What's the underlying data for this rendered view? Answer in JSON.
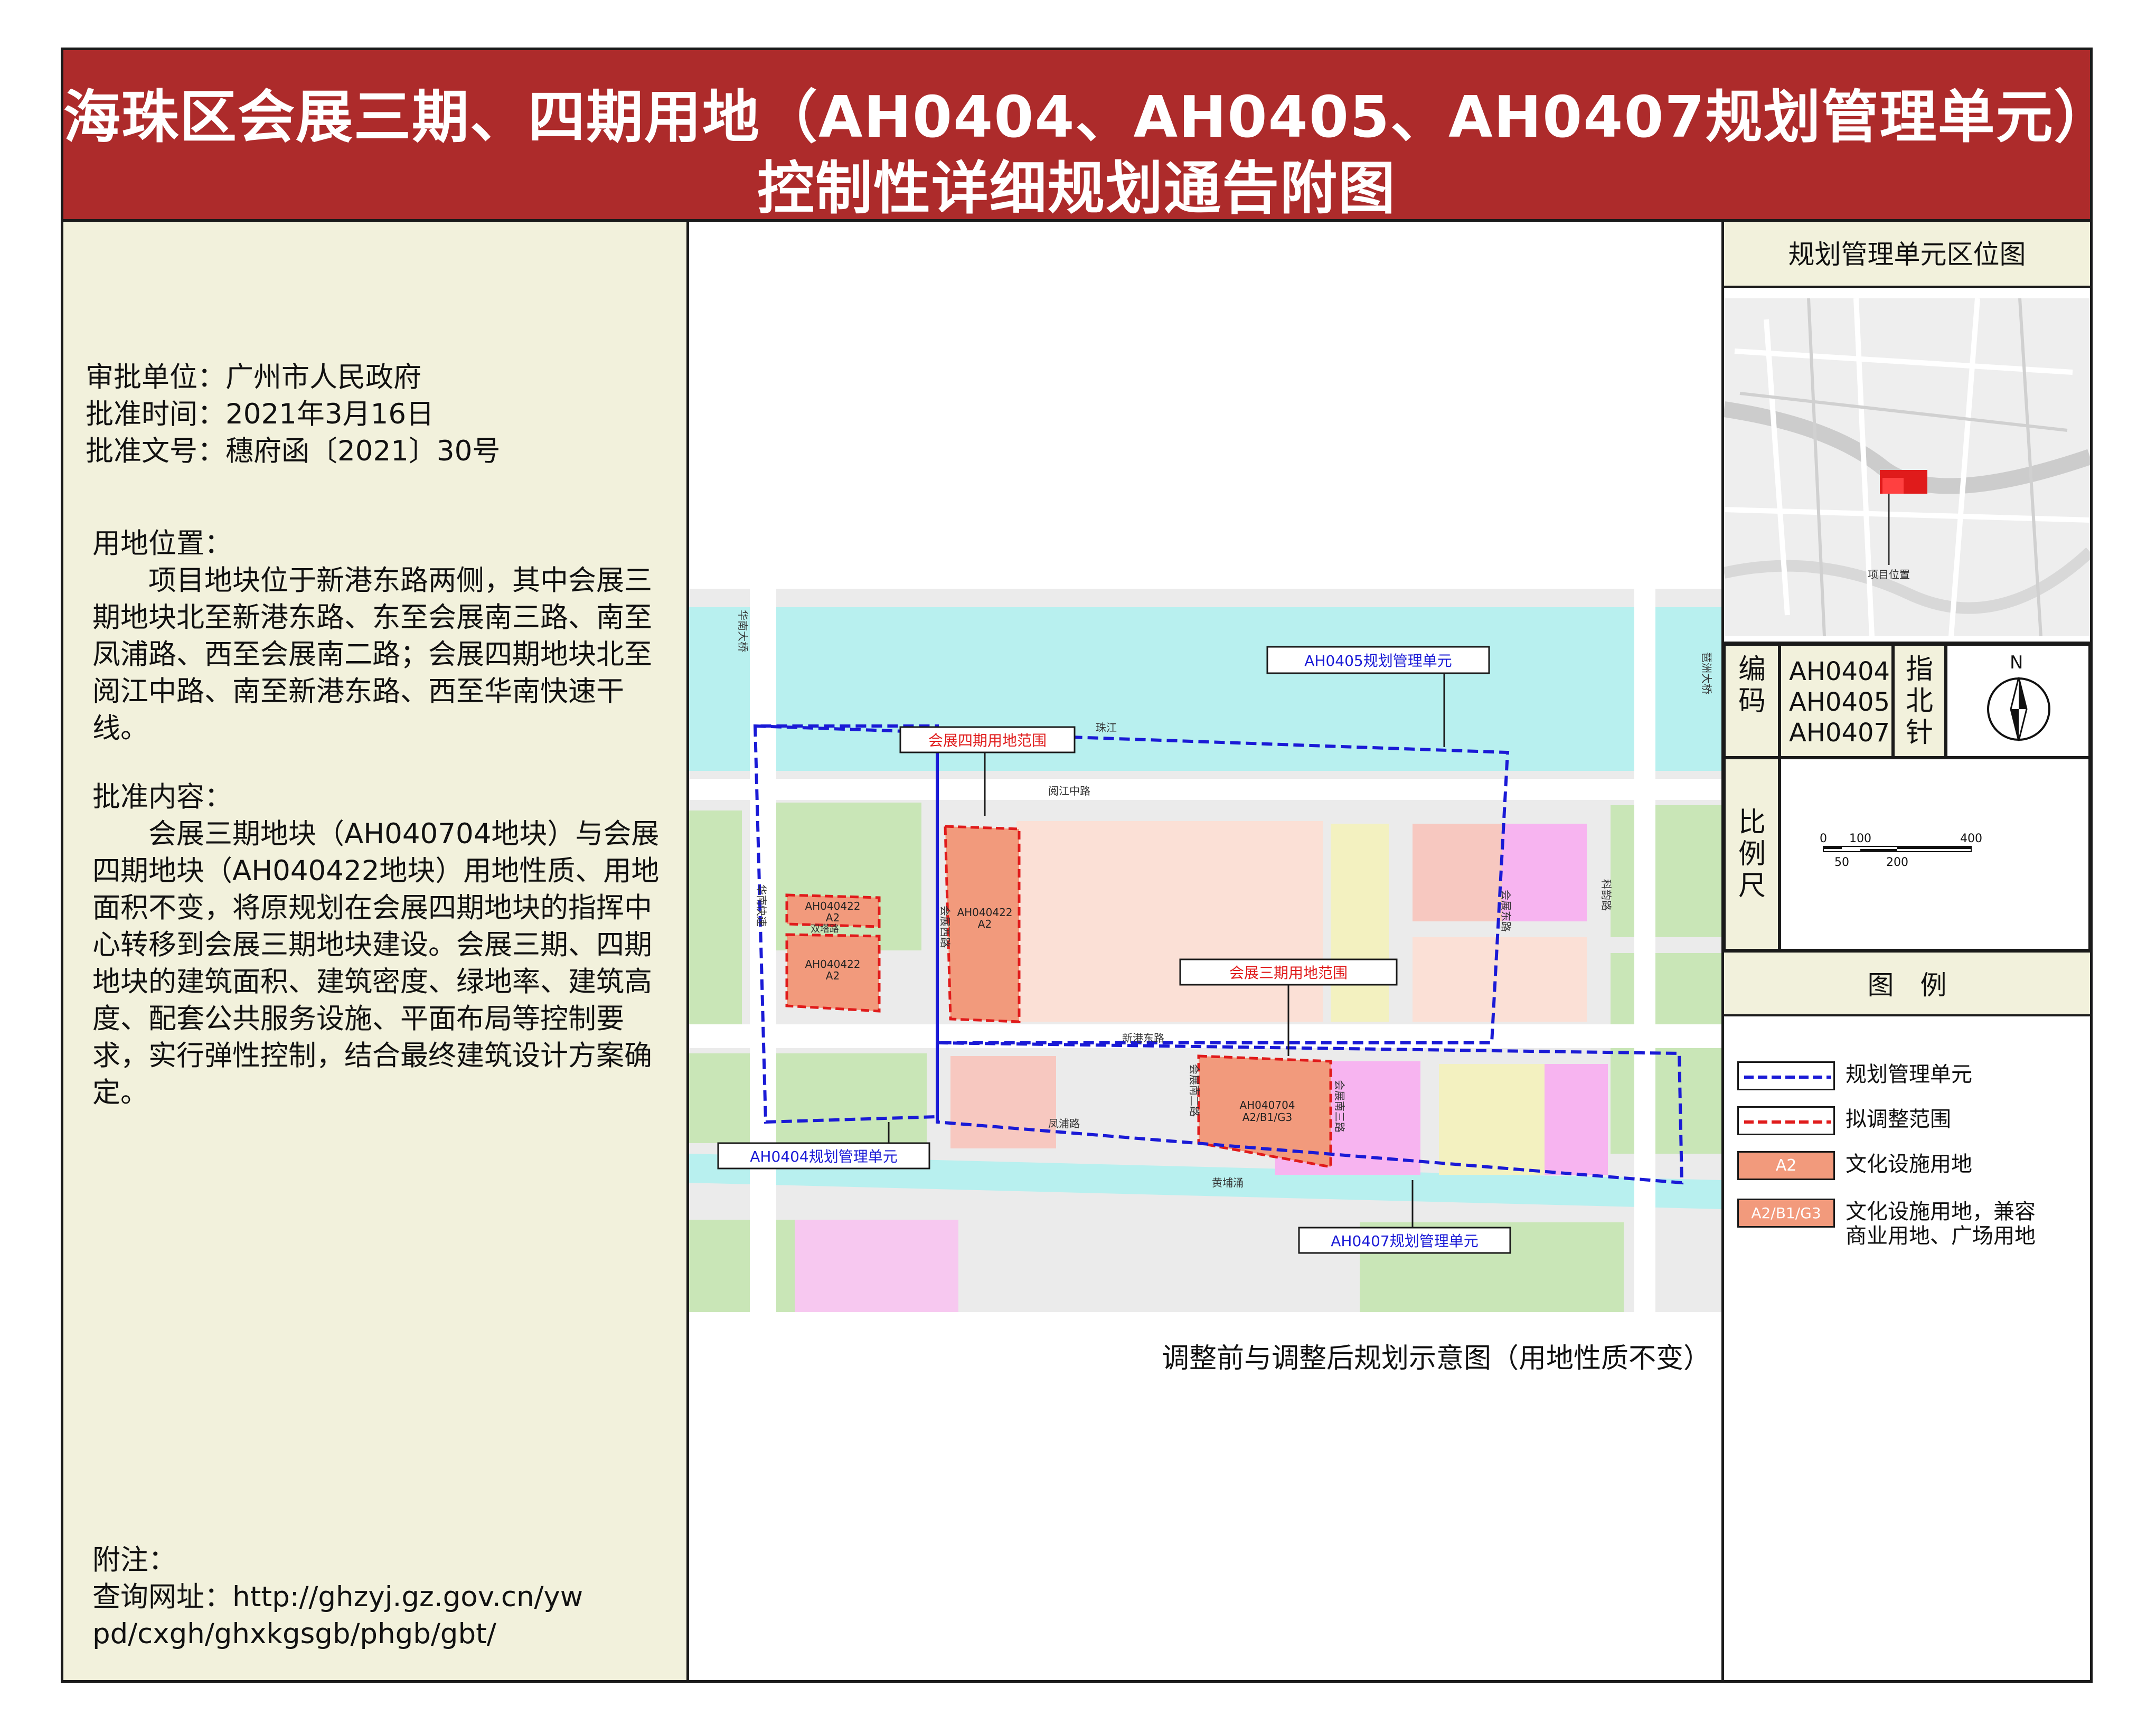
{
  "title": {
    "line1": "海珠区会展三期、四期用地（AH0404、AH0405、AH0407规划管理单元）",
    "line2": "控制性详细规划通告附图"
  },
  "approval": {
    "unit": "审批单位：广州市人民政府",
    "time": "批准时间：2021年3月16日",
    "doc": "批准文号：穗府函〔2021〕30号"
  },
  "location": {
    "heading": "用地位置：",
    "body": "项目地块位于新港东路两侧，其中会展三期地块北至新港东路、东至会展南三路、南至凤浦路、西至会展南二路；会展四期地块北至阅江中路、南至新港东路、西至华南快速干线。"
  },
  "content": {
    "heading": "批准内容：",
    "body": "会展三期地块（AH040704地块）与会展四期地块（AH040422地块）用地性质、用地面积不变，将原规划在会展四期地块的指挥中心转移到会展三期地块建设。会展三期、四期地块的建筑面积、建筑密度、绿地率、建筑高度、配套公共服务设施、平面布局等控制要求，实行弹性控制，结合最终建筑设计方案确定。"
  },
  "note": {
    "heading": "附注：",
    "url_line1": "查询网址：http://ghzyj.gz.gov.cn/yw",
    "url_line2": "pd/cxgh/ghxkgsgb/phgb/gbt/"
  },
  "map": {
    "caption": "调整前与调整后规划示意图（用地性质不变）",
    "unit_labels": {
      "ah0405": "AH0405规划管理单元",
      "ah0404": "AH0404规划管理单元",
      "ah0407": "AH0407规划管理单元"
    },
    "scope_labels": {
      "phase4": "会展四期用地范围",
      "phase3": "会展三期用地范围"
    },
    "parcels": {
      "p1_code": "AH040422",
      "p1_use": "A2",
      "p2_code": "AH040422",
      "p2_use": "A2",
      "p3_code": "AH040422",
      "p3_use": "A2",
      "p4_code": "AH040704",
      "p4_use": "A2/B1/G3"
    },
    "roads": {
      "huanan_bridge": "华南大桥",
      "huanan_express": "华南快速",
      "zhujiang": "珠江",
      "yuejiang": "阅江中路",
      "xingang": "新港东路",
      "fengpu": "凤浦路",
      "huangpu": "黄埔涌",
      "shuangta": "双塔路",
      "huizhan_west": "会展西路",
      "huizhan_east": "会展东路",
      "huizhan_s2": "会展南二路",
      "huizhan_s3": "会展南三路",
      "kejun": "科韵路",
      "pazhou_bridge": "琶洲大桥"
    }
  },
  "sidebar": {
    "location_map_title": "规划管理单元区位图",
    "project_location": "项目位置",
    "code_label": "编码",
    "codes": [
      "AH0404",
      "AH0405",
      "AH0407"
    ],
    "north_label": "指北针",
    "north_letter": "N",
    "scale_label": "比例尺",
    "scale_top": [
      "0",
      "100",
      "400"
    ],
    "scale_bottom": [
      "50",
      "200"
    ],
    "legend_title": "图　例",
    "legend": [
      {
        "label": "规划管理单元",
        "swatch_text": ""
      },
      {
        "label": "拟调整范围",
        "swatch_text": ""
      },
      {
        "label": "文化设施用地",
        "swatch_text": "A2"
      },
      {
        "label": "文化设施用地，兼容商业用地、广场用地",
        "swatch_text": "A2/B1/G3"
      }
    ]
  },
  "colors": {
    "title_bg": "#ad2b2b",
    "panel_bg": "#f2f1dc",
    "unit_boundary": "#1a1ad6",
    "adjust_boundary": "#e01b1b",
    "a2_fill": "#f29a7c",
    "river": "#b8f0ef"
  }
}
